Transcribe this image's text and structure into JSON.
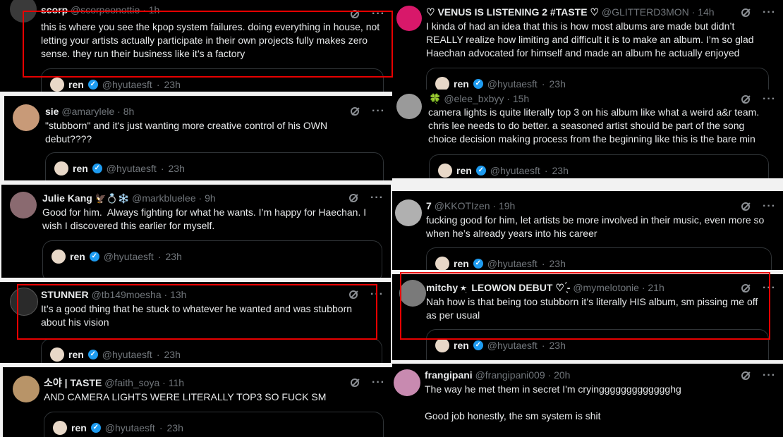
{
  "quote": {
    "name": "ren",
    "handle": "@hyutaesft",
    "time": "23h",
    "separator": "·"
  },
  "tweets": [
    {
      "name": "scorp",
      "handle": "@scorpeonottie",
      "time": "1h",
      "text": "this is where you see the kpop system failures. doing everything in house, not letting your artists actually participate in their own projects fully makes zero sense. they run their business like it’s a factory",
      "avatar_color": "#3a3a3a"
    },
    {
      "name": "sie",
      "handle": "@amarylele",
      "time": "8h",
      "text": "\"stubborn\" and it's just wanting more creative control of his OWN debut????",
      "avatar_color": "#c89a78"
    },
    {
      "name": "Julie Kang",
      "name_suffix": "🦅💍❄️",
      "handle": "@markbluelee",
      "time": "9h",
      "text": "Good for him.  Always fighting for what he wants. I’m happy for Haechan. I wish I discovered this earlier for myself.",
      "avatar_color": "#8a6a70"
    },
    {
      "name": "STUNNER",
      "handle": "@tb149moesha",
      "time": "13h",
      "text": "It’s a good thing that he stuck to whatever he wanted and was stubborn about his vision",
      "avatar_color": "#2a2a2a"
    },
    {
      "name": "소야 | TASTE",
      "handle": "@faith_soya",
      "time": "11h",
      "text": "AND CAMERA LIGHTS WERE LITERALLY TOP3 SO FUCK SM",
      "avatar_color": "#b89468"
    },
    {
      "name": "♡ VENUS IS LISTENING 2 #TASTE ♡",
      "handle": "@GLITTERD3MON",
      "time": "14h",
      "text": "I kinda of had an idea that this is how most albums are made but didn’t REALLY realize how limiting and difficult it is to make an album. I’m so glad Haechan advocated for himself and made an album he actually enjoyed",
      "avatar_color": "#d8186a"
    },
    {
      "name": "🍀",
      "handle": "@elee_bxbyy",
      "time": "15h",
      "text": "camera lights is quite literally top 3 on his album like what a weird a&r team. chris lee needs to do better. a seasoned artist should be part of the song choice decision making process from the beginning like this is the bare min",
      "avatar_color": "#9a9a9a"
    },
    {
      "name": "7",
      "handle": "@KKOTIzen",
      "time": "19h",
      "text": "fucking good for him, let artists be more involved in their music, even more so when he’s already years into his career",
      "avatar_color": "#b0b0b0"
    },
    {
      "name": "mitchy ⭒ּ ִ LEOWON DEBUT ♡ ̖́-",
      "handle": "@mymelotonie",
      "time": "21h",
      "text": "Nah how is that being too stubborn it’s literally HIS album, sm pissing me off as per usual",
      "avatar_color": "#7a7a7a"
    },
    {
      "name": "frangipani",
      "handle": "@frangipani009",
      "time": "20h",
      "text": "The way he met them in secret I'm cryinggggggggggggghg\n\nGood job honestly, the sm system is shit",
      "avatar_color": "#c88ab0"
    }
  ]
}
